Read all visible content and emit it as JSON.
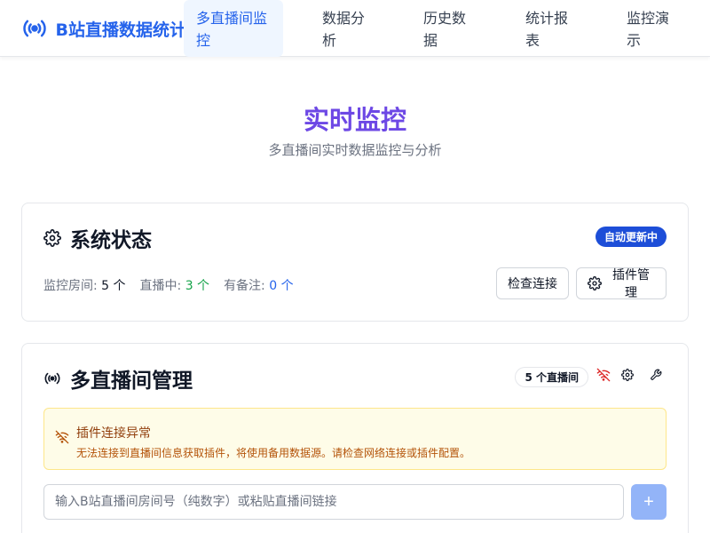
{
  "header": {
    "brand_icon": "broadcast-icon",
    "brand_text": "B站直播数据统计",
    "nav": [
      {
        "line1": "多直播间监",
        "line2": "控",
        "active": true
      },
      {
        "line1": "数据分",
        "line2": "析",
        "active": false
      },
      {
        "line1": "历史数",
        "line2": "据",
        "active": false
      },
      {
        "line1": "统计报",
        "line2": "表",
        "active": false
      },
      {
        "line1": "监控演",
        "line2": "示",
        "active": false
      }
    ]
  },
  "hero": {
    "title": "实时监控",
    "subtitle": "多直播间实时数据监控与分析"
  },
  "status_card": {
    "icon": "gear-icon",
    "title": "系统状态",
    "badge": "自动更新中",
    "stats": [
      {
        "label": "监控房间:",
        "value": "5 个"
      },
      {
        "label": "直播中:",
        "value": "3 个"
      },
      {
        "label": "有备注:",
        "value": "0 个"
      }
    ],
    "check_button": "检查连接",
    "plugin_button": "插件管理"
  },
  "rooms_card": {
    "icon": "broadcast-icon",
    "title": "多直播间管理",
    "count_badge": "5 个直播间",
    "tool_icons": [
      "wifi-off-icon",
      "gear-icon",
      "wrench-icon"
    ],
    "alert": {
      "icon": "wifi-off-icon",
      "title": "插件连接异常",
      "message": "无法连接到直播间信息获取插件，将使用备用数据源。请检查网络连接或插件配置。"
    },
    "input_placeholder": "输入B站直播间房间号（纯数字）或粘贴直播间链接",
    "add_label": "+"
  },
  "colors": {
    "primary": "#2563eb",
    "hero": "#6d48e5",
    "live": "#16a34a",
    "warning": "#92400e"
  }
}
